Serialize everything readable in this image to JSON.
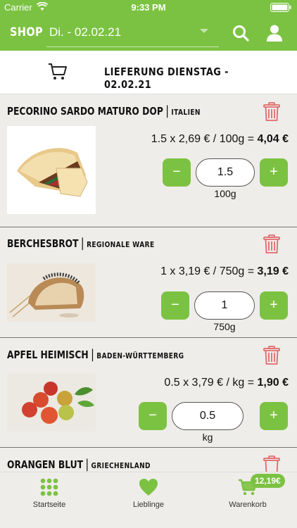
{
  "status_bar": {
    "carrier": "Carrier",
    "time": "9:33 PM"
  },
  "nav": {
    "title": "SHOP",
    "date_value": "Di. - 02.02.21"
  },
  "delivery": {
    "label": "LIEFERUNG DIENSTAG - 02.02.21"
  },
  "items": [
    {
      "name": "PECORINO SARDO MATURO DOP",
      "origin": "ITALIEN",
      "price_formula": "1.5 x 2,69 € / 100g = ",
      "price_total": "4,04 €",
      "quantity": "1.5",
      "unit": "100g",
      "minus": "−",
      "plus": "+"
    },
    {
      "name": "BERCHESBROT",
      "origin": "REGIONALE WARE",
      "price_formula": "1 x 3,19 € / 750g = ",
      "price_total": "3,19 €",
      "quantity": "1",
      "unit": "750g",
      "minus": "−",
      "plus": "+"
    },
    {
      "name": "APFEL HEIMISCH",
      "origin": "BADEN-WÜRTTEMBERG",
      "price_formula": "0.5 x 3,79 € / kg = ",
      "price_total": "1,90 €",
      "quantity": "0.5",
      "unit": "kg",
      "minus": "−",
      "plus": "+"
    },
    {
      "name": "ORANGEN BLUT",
      "origin": "GRIECHENLAND"
    }
  ],
  "tabs": [
    {
      "label": "Startseite",
      "icon": "grid-icon"
    },
    {
      "label": "Lieblinge",
      "icon": "heart-icon"
    },
    {
      "label": "Warenkorb",
      "icon": "cart-icon"
    }
  ],
  "cart_badge": "12,19€",
  "colors": {
    "brand_green": "#7cc242",
    "trash_red": "#d9534f",
    "background": "#efedea"
  }
}
